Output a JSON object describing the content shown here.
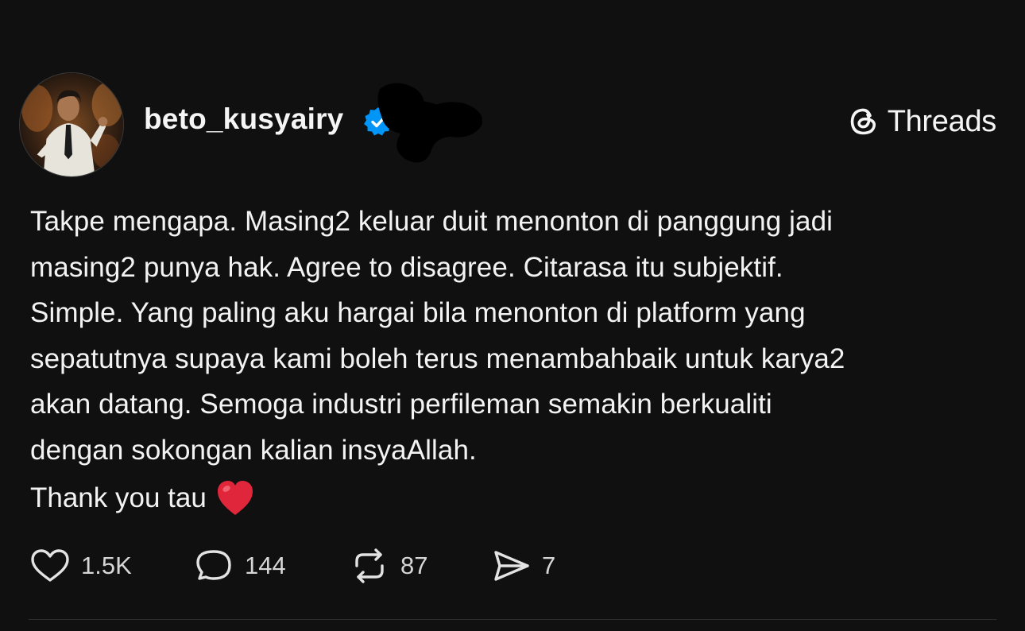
{
  "post": {
    "username": "beto_kusyairy",
    "verified_icon": "verified-badge-icon",
    "body": "Takpe mengapa. Masing2 keluar duit menonton di panggung jadi\nmasing2 punya hak. Agree to disagree. Citarasa itu subjektif.\nSimple. Yang paling aku hargai bila menonton di platform yang\nsepatutnya supaya kami boleh terus menambahbaik untuk karya2\nakan datang. Semoga industri perfileman semakin berkualiti\ndengan sokongan kalian insyaAllah.",
    "closing": "Thank you tau",
    "closing_emoji": "red-heart-icon"
  },
  "brand": {
    "name": "Threads",
    "icon": "threads-logo-icon"
  },
  "actions": {
    "likes": "1.5K",
    "replies": "144",
    "reposts": "87",
    "shares": "7"
  },
  "colors": {
    "background": "#101010",
    "text": "#f3f3f3",
    "verified": "#0095f6",
    "heart": "#e0263a"
  }
}
